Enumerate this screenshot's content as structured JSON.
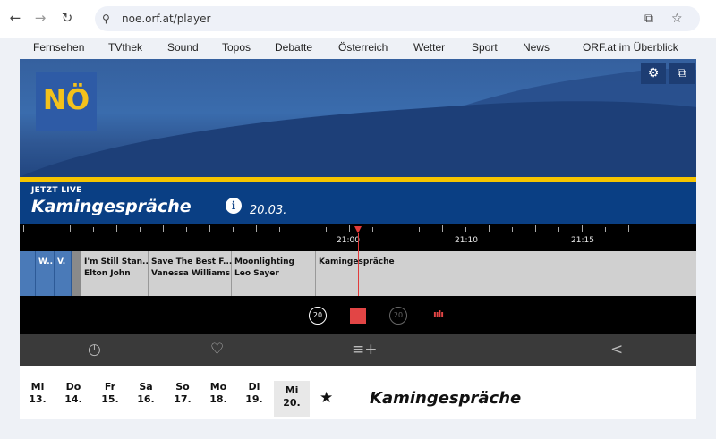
{
  "browser": {
    "back_icon": "←",
    "forward_icon": "→",
    "reload_icon": "↻",
    "tune_icon": "⚲",
    "url": "noe.orf.at/player",
    "cast_icon": "⧉",
    "star_icon": "☆"
  },
  "orf_nav": [
    "Fernsehen",
    "TVthek",
    "Sound",
    "Topos",
    "Debatte",
    "Österreich",
    "Wetter",
    "Sport",
    "News",
    "ORF.at im Überblick"
  ],
  "player": {
    "logo": "NÖ",
    "settings_icon": "⚙",
    "fullscreen_icon": "⧉",
    "live_label": "JETZT LIVE",
    "title": "Kamingespräche",
    "info_icon": "i",
    "date": "20.03.",
    "time_labels": [
      "21:00",
      "21:10",
      "21:15"
    ],
    "programs": [
      {
        "line1": "W..",
        "line2": ""
      },
      {
        "line1": "V.",
        "line2": ""
      },
      {
        "line1": "I'm Still Stan...",
        "line2": "Elton John"
      },
      {
        "line1": "Save The Best F...",
        "line2": "Vanessa Williams"
      },
      {
        "line1": "Moonlighting",
        "line2": "Leo Sayer"
      },
      {
        "line1": "Kamingespräche",
        "line2": ""
      }
    ],
    "rewind_label": "20",
    "forward_label": "20",
    "volume_icon": "ıılı",
    "actions": {
      "history_icon": "◷",
      "favorite_icon": "♡",
      "playlist_icon": "≡+",
      "share_icon": "<"
    }
  },
  "days": [
    {
      "wd": "Mi",
      "d": "13."
    },
    {
      "wd": "Do",
      "d": "14."
    },
    {
      "wd": "Fr",
      "d": "15."
    },
    {
      "wd": "Sa",
      "d": "16."
    },
    {
      "wd": "So",
      "d": "17."
    },
    {
      "wd": "Mo",
      "d": "18."
    },
    {
      "wd": "Di",
      "d": "19."
    },
    {
      "wd": "Mi",
      "d": "20."
    }
  ],
  "favorite_star": "★",
  "day_title": "Kamingespräche"
}
